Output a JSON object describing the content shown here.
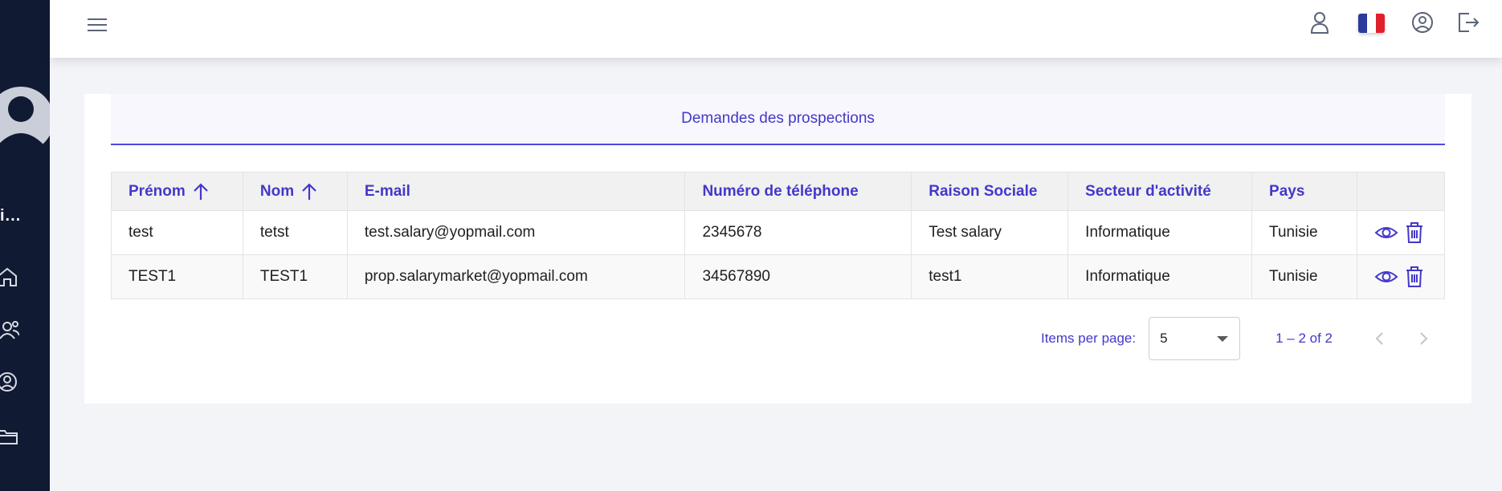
{
  "sidebar": {
    "user_name": "i...",
    "items": [
      {
        "icon": "home-icon"
      },
      {
        "icon": "users-icon"
      },
      {
        "icon": "user-circle-icon"
      },
      {
        "icon": "folder-icon"
      }
    ]
  },
  "topbar": {
    "icons": [
      "menu-icon",
      "user-icon",
      "flag-fr-icon",
      "account-circle-icon",
      "logout-icon"
    ],
    "flag_colors": [
      "#2b3a9b",
      "#ffffff",
      "#e01f2d"
    ]
  },
  "page": {
    "title": "Demandes des prospections"
  },
  "table": {
    "columns": [
      "Prénom",
      "Nom",
      "E-mail",
      "Numéro de téléphone",
      "Raison Sociale",
      "Secteur d'activité",
      "Pays",
      ""
    ],
    "rows": [
      [
        "test",
        "tetst",
        "test.salary@yopmail.com",
        "2345678",
        "Test salary",
        "Informatique",
        "Tunisie"
      ],
      [
        "TEST1",
        "TEST1",
        "prop.salarymarket@yopmail.com",
        "34567890",
        "test1",
        "Informatique",
        "Tunisie"
      ]
    ]
  },
  "paginator": {
    "items_per_page_label": "Items per page:",
    "page_size": "5",
    "range_label": "1 – 2 of 2"
  },
  "colors": {
    "accent": "#4338ca",
    "sidebar_bg": "#101a33"
  }
}
